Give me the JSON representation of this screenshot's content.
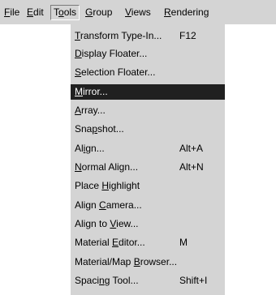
{
  "menubar": {
    "items": [
      {
        "pre": "",
        "acc": "F",
        "post": "ile"
      },
      {
        "pre": "",
        "acc": "E",
        "post": "dit"
      },
      {
        "pre": "T",
        "acc": "o",
        "post": "ols"
      },
      {
        "pre": "",
        "acc": "G",
        "post": "roup"
      },
      {
        "pre": "",
        "acc": "V",
        "post": "iews"
      },
      {
        "pre": "",
        "acc": "R",
        "post": "endering"
      }
    ],
    "active_index": 2
  },
  "tools_menu": {
    "items": [
      {
        "pre": "",
        "acc": "T",
        "post": "ransform Type-In...",
        "shortcut": "F12"
      },
      {
        "pre": "",
        "acc": "D",
        "post": "isplay Floater...",
        "shortcut": ""
      },
      {
        "pre": "",
        "acc": "S",
        "post": "election Floater...",
        "shortcut": ""
      },
      {
        "pre": "",
        "acc": "M",
        "post": "irror...",
        "shortcut": ""
      },
      {
        "pre": "",
        "acc": "A",
        "post": "rray...",
        "shortcut": ""
      },
      {
        "pre": "Sna",
        "acc": "p",
        "post": "shot...",
        "shortcut": ""
      },
      {
        "pre": "Al",
        "acc": "i",
        "post": "gn...",
        "shortcut": "Alt+A"
      },
      {
        "pre": "",
        "acc": "N",
        "post": "ormal Align...",
        "shortcut": "Alt+N"
      },
      {
        "pre": "Place ",
        "acc": "H",
        "post": "ighlight",
        "shortcut": ""
      },
      {
        "pre": "Align ",
        "acc": "C",
        "post": "amera...",
        "shortcut": ""
      },
      {
        "pre": "Align to ",
        "acc": "V",
        "post": "iew...",
        "shortcut": ""
      },
      {
        "pre": "Material ",
        "acc": "E",
        "post": "ditor...",
        "shortcut": "M"
      },
      {
        "pre": "Material/Map ",
        "acc": "B",
        "post": "rowser...",
        "shortcut": ""
      },
      {
        "pre": "Spaci",
        "acc": "n",
        "post": "g Tool...",
        "shortcut": "Shift+I"
      }
    ],
    "selected_index": 3
  }
}
